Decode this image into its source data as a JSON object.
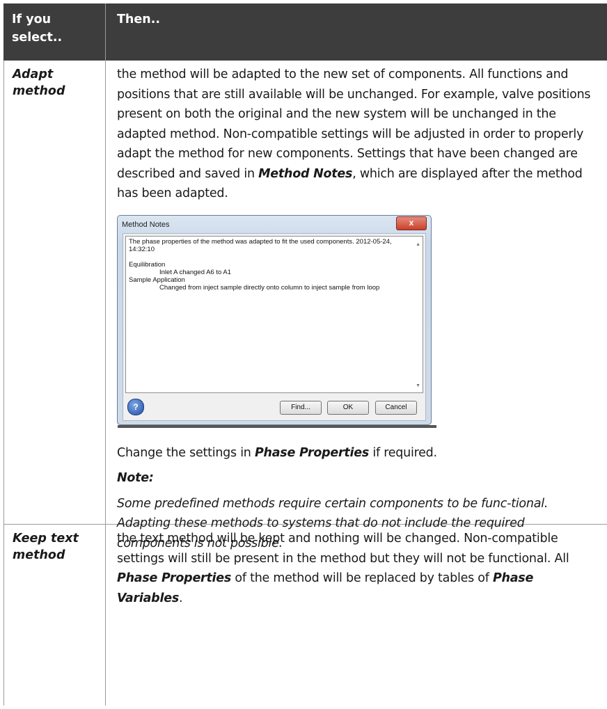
{
  "table": {
    "header": {
      "col1": "If you select..",
      "col2": "Then.."
    },
    "rows": [
      {
        "label": "Adapt method",
        "para1": {
          "before": "the method will be adapted to the new set of components. All functions and positions that are still available will be unchanged. For example, valve positions present on both the original and the new system will be unchanged in the adapted method. Non-compatible settings will be adjusted in order to properly adapt the method for new components. Settings that have been changed are described and saved in ",
          "bold": "Method Notes",
          "after": ", which are displayed after the method has been adapted."
        },
        "dialog": {
          "title": "Method Notes",
          "close_label": "x",
          "lines": {
            "l1": "The phase properties of the method was adapted to fit the used components. 2012-05-24, 14:32:10",
            "l2": "Equilibration",
            "l3": "Inlet A changed A6 to A1",
            "l4": "Sample Application",
            "l5": "Changed from inject sample directly onto column to inject sample from loop"
          },
          "buttons": {
            "find": "Find...",
            "ok": "OK",
            "cancel": "Cancel"
          },
          "help_icon": "question-mark-icon"
        },
        "para2": {
          "before": "Change the settings in ",
          "bold": "Phase Properties",
          "after": " if required."
        },
        "note_heading": "Note:",
        "note_text": "Some predefined methods require certain components to be func-tional. Adapting these methods to systems that do not include the required components is not possible."
      },
      {
        "label": "Keep text method",
        "para": {
          "t1": "the text method will be kept and nothing will be changed. Non-compatible settings will still be present in the method but they will not be functional. All ",
          "b1": "Phase Properties",
          "t2": " of the method will be replaced by tables of ",
          "b2": "Phase Variables",
          "t3": "."
        }
      }
    ]
  }
}
